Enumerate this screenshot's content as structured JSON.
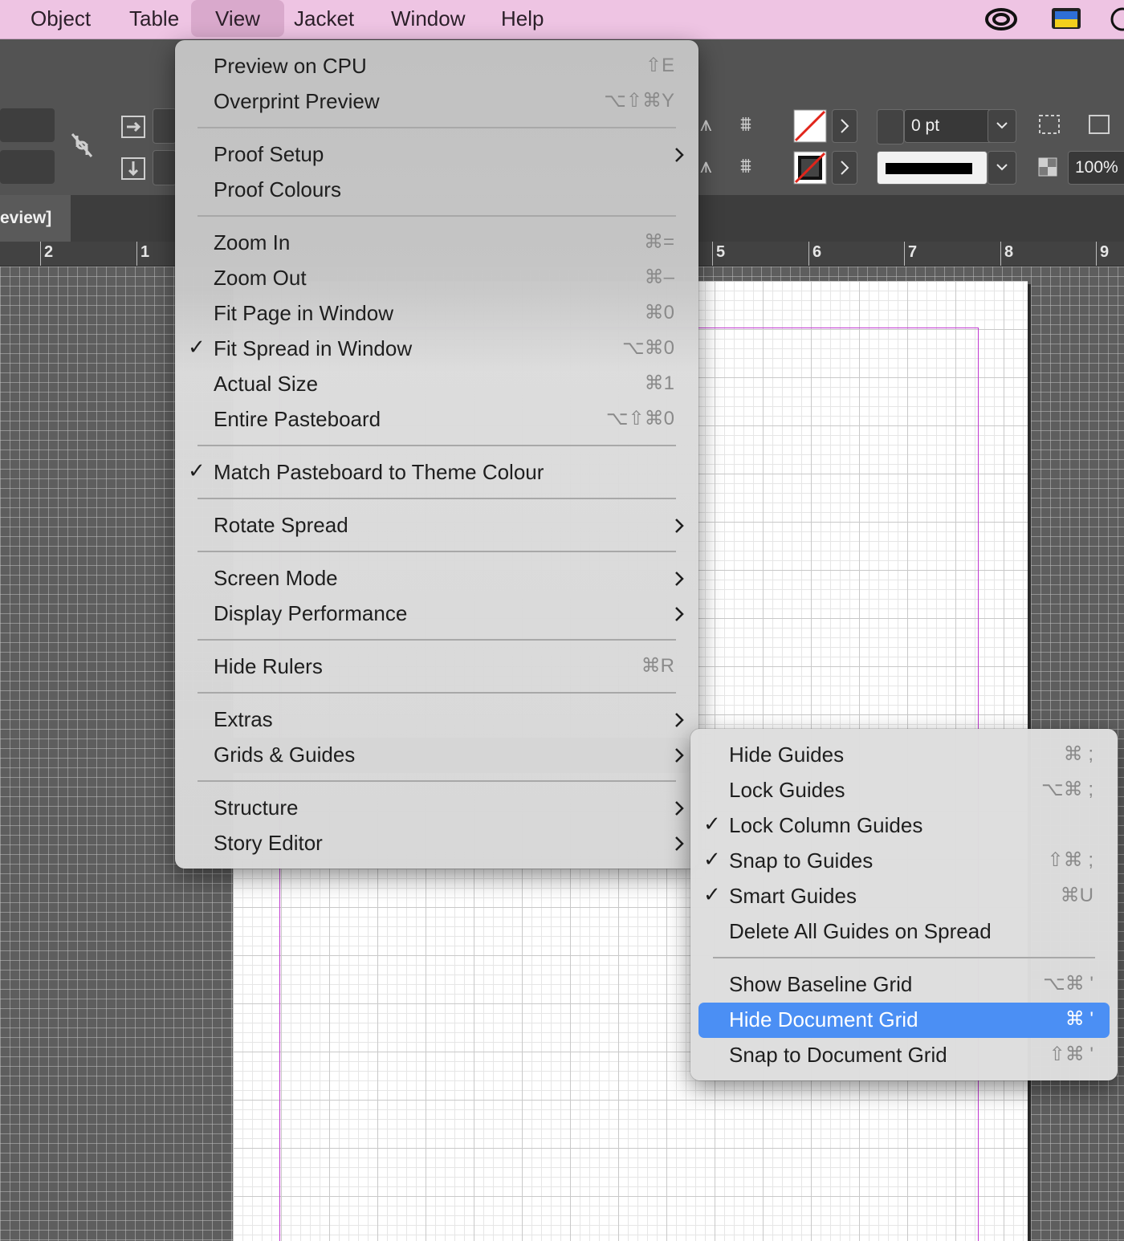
{
  "menubar": {
    "items": [
      "Object",
      "Table",
      "View",
      "Jacket",
      "Window",
      "Help"
    ],
    "active": "View"
  },
  "document_tab": {
    "title": "eview]"
  },
  "control_bar": {
    "stroke_weight": "0 pt",
    "opacity": "100%"
  },
  "ruler": {
    "labels": [
      "2",
      "1",
      "5",
      "6",
      "7",
      "8",
      "9"
    ]
  },
  "view_menu": {
    "items": [
      {
        "label": "Preview on CPU",
        "shortcut": "⇧E",
        "checked": false,
        "submenu": false
      },
      {
        "label": "Overprint Preview",
        "shortcut": "⌥⇧⌘Y",
        "checked": false,
        "submenu": false
      },
      {
        "label": "Proof Setup",
        "shortcut": "",
        "checked": false,
        "submenu": true
      },
      {
        "label": "Proof Colours",
        "shortcut": "",
        "checked": false,
        "submenu": false
      },
      {
        "label": "Zoom In",
        "shortcut": "⌘=",
        "checked": false,
        "submenu": false
      },
      {
        "label": "Zoom Out",
        "shortcut": "⌘–",
        "checked": false,
        "submenu": false
      },
      {
        "label": "Fit Page in Window",
        "shortcut": "⌘0",
        "checked": false,
        "submenu": false
      },
      {
        "label": "Fit Spread in Window",
        "shortcut": "⌥⌘0",
        "checked": true,
        "submenu": false
      },
      {
        "label": "Actual Size",
        "shortcut": "⌘1",
        "checked": false,
        "submenu": false
      },
      {
        "label": "Entire Pasteboard",
        "shortcut": "⌥⇧⌘0",
        "checked": false,
        "submenu": false
      },
      {
        "label": "Match Pasteboard to Theme Colour",
        "shortcut": "",
        "checked": true,
        "submenu": false
      },
      {
        "label": "Rotate Spread",
        "shortcut": "",
        "checked": false,
        "submenu": true
      },
      {
        "label": "Screen Mode",
        "shortcut": "",
        "checked": false,
        "submenu": true
      },
      {
        "label": "Display Performance",
        "shortcut": "",
        "checked": false,
        "submenu": true
      },
      {
        "label": "Hide Rulers",
        "shortcut": "⌘R",
        "checked": false,
        "submenu": false
      },
      {
        "label": "Extras",
        "shortcut": "",
        "checked": false,
        "submenu": true
      },
      {
        "label": "Grids & Guides",
        "shortcut": "",
        "checked": false,
        "submenu": true,
        "selected": true
      },
      {
        "label": "Structure",
        "shortcut": "",
        "checked": false,
        "submenu": true
      },
      {
        "label": "Story Editor",
        "shortcut": "",
        "checked": false,
        "submenu": true
      }
    ]
  },
  "grids_submenu": {
    "items": [
      {
        "label": "Hide Guides",
        "shortcut": "⌘ ;",
        "checked": false
      },
      {
        "label": "Lock Guides",
        "shortcut": "⌥⌘ ;",
        "checked": false
      },
      {
        "label": "Lock Column Guides",
        "shortcut": "",
        "checked": true
      },
      {
        "label": "Snap to Guides",
        "shortcut": "⇧⌘ ;",
        "checked": true
      },
      {
        "label": "Smart Guides",
        "shortcut": "⌘U",
        "checked": true
      },
      {
        "label": "Delete All Guides on Spread",
        "shortcut": "",
        "checked": false
      },
      {
        "label": "Show Baseline Grid",
        "shortcut": "⌥⌘ '",
        "checked": false
      },
      {
        "label": "Hide Document Grid",
        "shortcut": "⌘ '",
        "checked": false,
        "highlighted": true
      },
      {
        "label": "Snap to Document Grid",
        "shortcut": "⇧⌘ '",
        "checked": false
      }
    ]
  },
  "colors": {
    "menubar": "#eec4e3",
    "highlight": "#4b8ff4",
    "margin_guide": "#c13ad1"
  }
}
